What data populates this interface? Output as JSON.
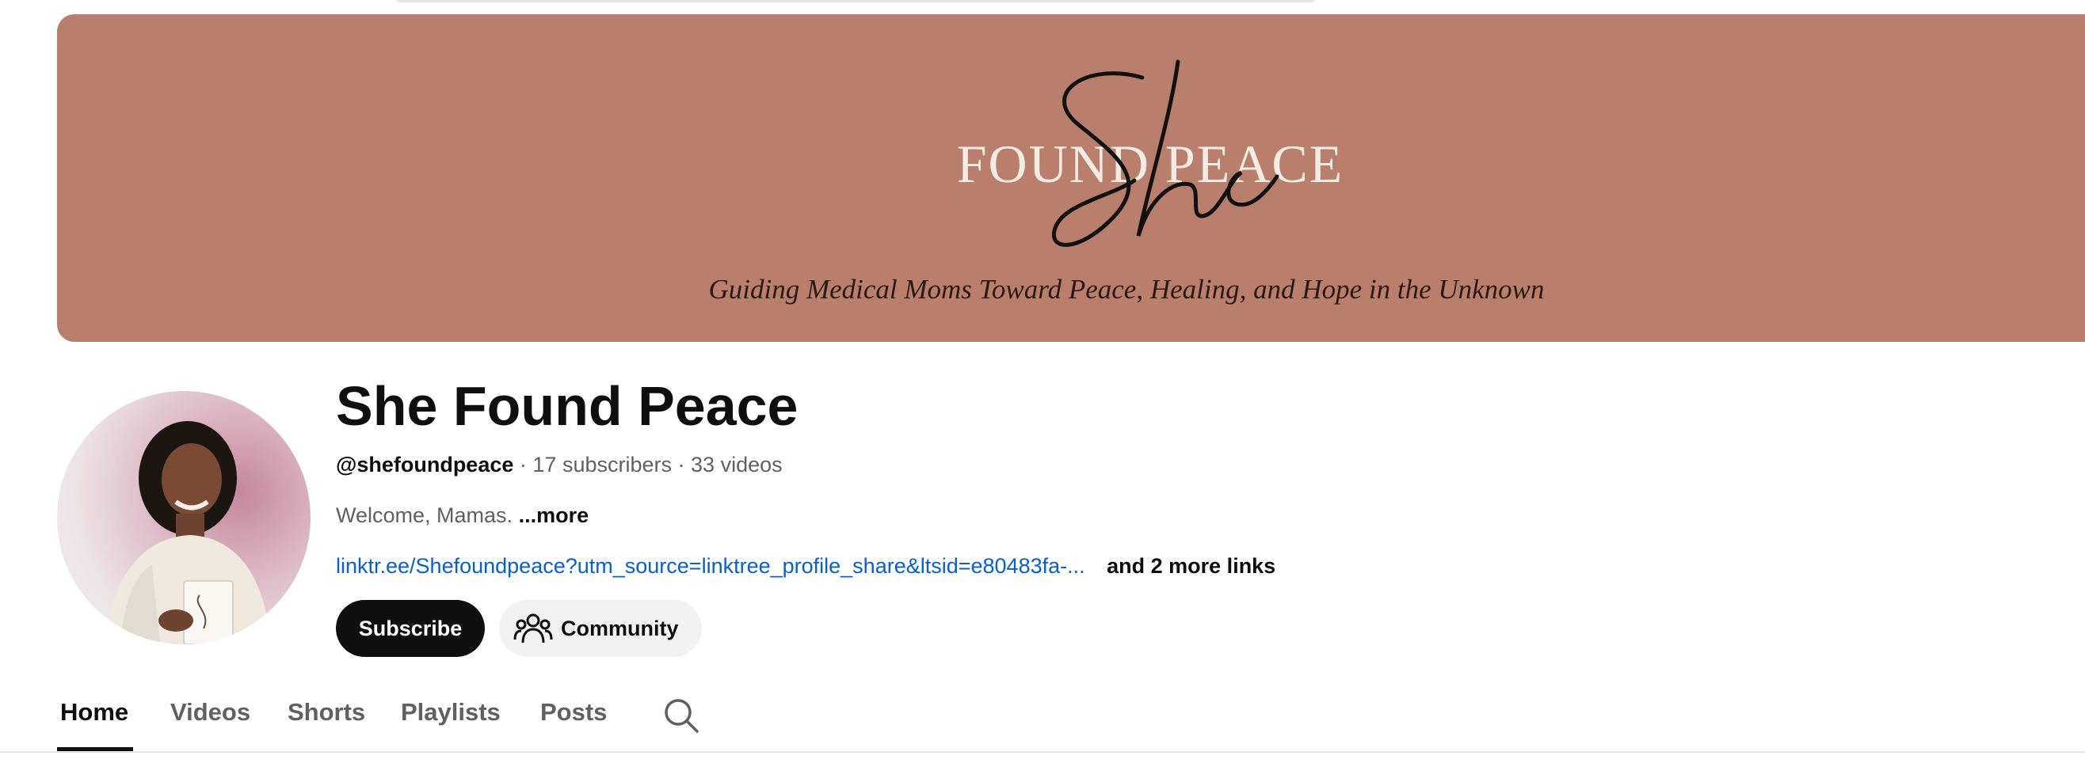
{
  "banner": {
    "brand_word_found": "FOUND PEACE",
    "brand_script": "She",
    "tagline": "Guiding Medical Moms Toward Peace, Healing, and Hope in the Unknown",
    "background_color": "#b97f6c"
  },
  "avatar": {
    "icon": "profile-photo"
  },
  "channel": {
    "title": "She Found Peace",
    "handle": "@shefoundpeace",
    "separator": "·",
    "subscribers": "17 subscribers",
    "videos": "33 videos",
    "description": "Welcome, Mamas.",
    "more_label": "...more",
    "link_text": "linktr.ee/Shefoundpeace?utm_source=linktree_profile_share&ltsid=e80483fa-...",
    "more_links_label": "and 2 more links"
  },
  "actions": {
    "subscribe_label": "Subscribe",
    "community_label": "Community",
    "community_icon": "people-icon"
  },
  "tabs": [
    {
      "label": "Home",
      "active": true
    },
    {
      "label": "Videos",
      "active": false
    },
    {
      "label": "Shorts",
      "active": false
    },
    {
      "label": "Playlists",
      "active": false
    },
    {
      "label": "Posts",
      "active": false
    }
  ],
  "tab_search_icon": "search-icon",
  "colors": {
    "link": "#065fd4",
    "subscribe_bg": "#0f0f0f",
    "secondary_text": "#606060"
  }
}
